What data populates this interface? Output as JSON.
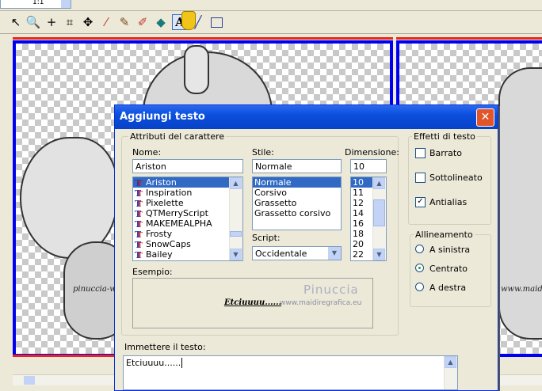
{
  "app": {
    "zoom_value": "1:1"
  },
  "toolbar": {
    "tools": [
      "pointer-tool",
      "zoom-tool",
      "move-tool",
      "crop-tool",
      "pan-tool",
      "dropper-tool",
      "brush-tool",
      "eraser-tool",
      "fill-tool",
      "text-tool",
      "line-tool",
      "rectangle-tool"
    ]
  },
  "canvas": {
    "watermark_left": "pinuccia-w",
    "watermark_right": "www.maidr"
  },
  "dialog": {
    "title": "Aggiungi testo",
    "char_attrs_group": "Attributi del carattere",
    "name_label": "Nome:",
    "name_value": "Ariston",
    "fonts": [
      "Ariston",
      "Inspiration",
      "Pixelette",
      "QTMerryScript",
      "MAKEMEALPHA",
      "Frosty",
      "SnowCaps",
      "Bailey"
    ],
    "style_label": "Stile:",
    "style_value": "Normale",
    "styles": [
      "Normale",
      "Corsivo",
      "Grassetto",
      "Grassetto corsivo"
    ],
    "size_label": "Dimensione:",
    "size_value": "10",
    "sizes": [
      "10",
      "11",
      "12",
      "14",
      "16",
      "18",
      "20",
      "22"
    ],
    "script_label": "Script:",
    "script_value": "Occidentale",
    "sample_label": "Esempio:",
    "sample_text": "Etciuuuu......",
    "sample_watermark_1": "Pinuccia",
    "sample_watermark_2": "www.maidiregrafica.eu",
    "effects_group": "Effetti di testo",
    "effect_strike": "Barrato",
    "effect_underline": "Sottolineato",
    "effect_antialias": "Antialias",
    "align_group": "Allineamento",
    "align_left": "A sinistra",
    "align_center": "Centrato",
    "align_right": "A destra",
    "input_label": "Immettere il testo:",
    "input_value": "Etciuuuu......"
  },
  "colors": {
    "title_bar": "#0a4fdc",
    "selection": "#316ac5",
    "doc_border": "#0000f0",
    "accent_red": "#e8261a"
  }
}
